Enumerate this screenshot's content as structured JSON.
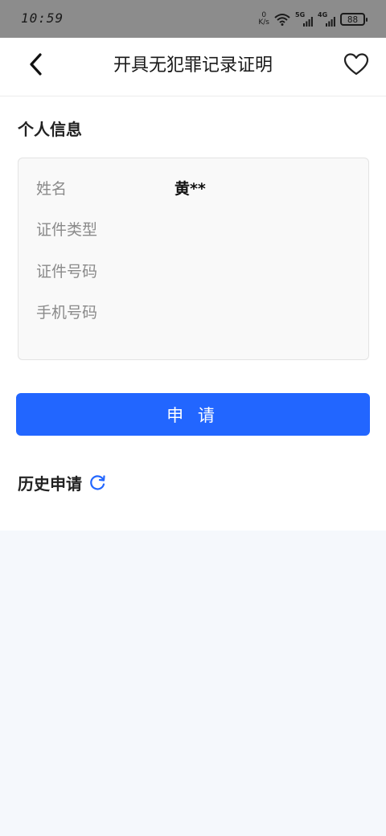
{
  "status_bar": {
    "time": "10:59",
    "net_speed_value": "0",
    "net_speed_unit": "K/s",
    "sim1_type": "5G",
    "sim2_type": "4G",
    "battery": "88"
  },
  "header": {
    "title": "开具无犯罪记录证明",
    "back_icon": "chevron-left-icon",
    "favorite_icon": "heart-outline-icon"
  },
  "personal_info": {
    "section_title": "个人信息",
    "rows": [
      {
        "label": "姓名",
        "value": "黄**"
      },
      {
        "label": "证件类型",
        "value": ""
      },
      {
        "label": "证件号码",
        "value": ""
      },
      {
        "label": "手机号码",
        "value": ""
      }
    ]
  },
  "apply_button": {
    "label": "申 请"
  },
  "history": {
    "section_title": "历史申请",
    "refresh_icon": "refresh-icon"
  },
  "colors": {
    "primary": "#2266ff",
    "status_bar_bg": "#8c8c8c",
    "card_bg": "#f9f9f9",
    "history_bg": "#f5f8fc"
  }
}
